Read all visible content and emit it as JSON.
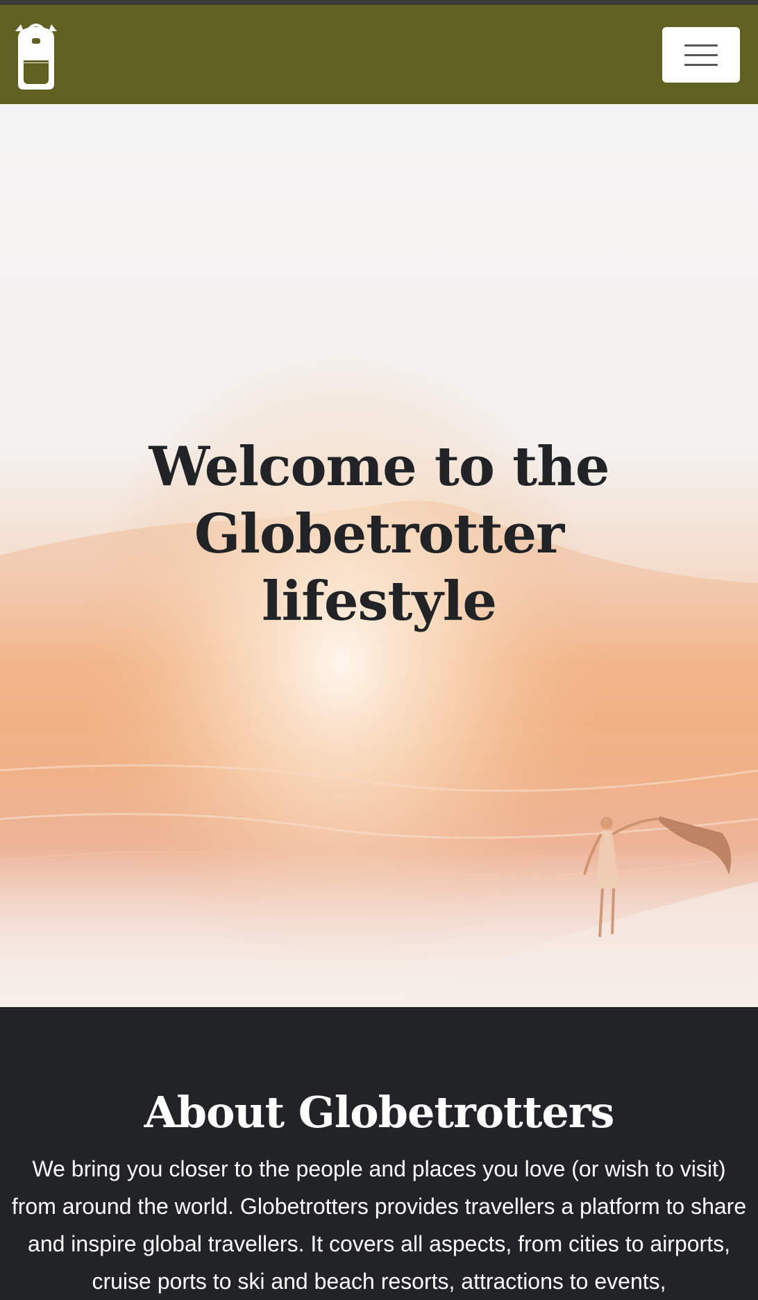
{
  "navbar": {
    "logo_icon": "backpack-icon",
    "menu_icon": "hamburger-menu-icon",
    "background_color": "#606020"
  },
  "hero": {
    "title": "Welcome to the Globetrotter lifestyle"
  },
  "about": {
    "title": "About Globetrotters",
    "text": "We bring you closer to the people and places you love (or wish to visit) from around the world. Globetrotters provides travellers a platform to share and inspire global travellers. It covers all aspects, from cities to airports, cruise ports to ski and beach resorts, attractions to events,"
  }
}
